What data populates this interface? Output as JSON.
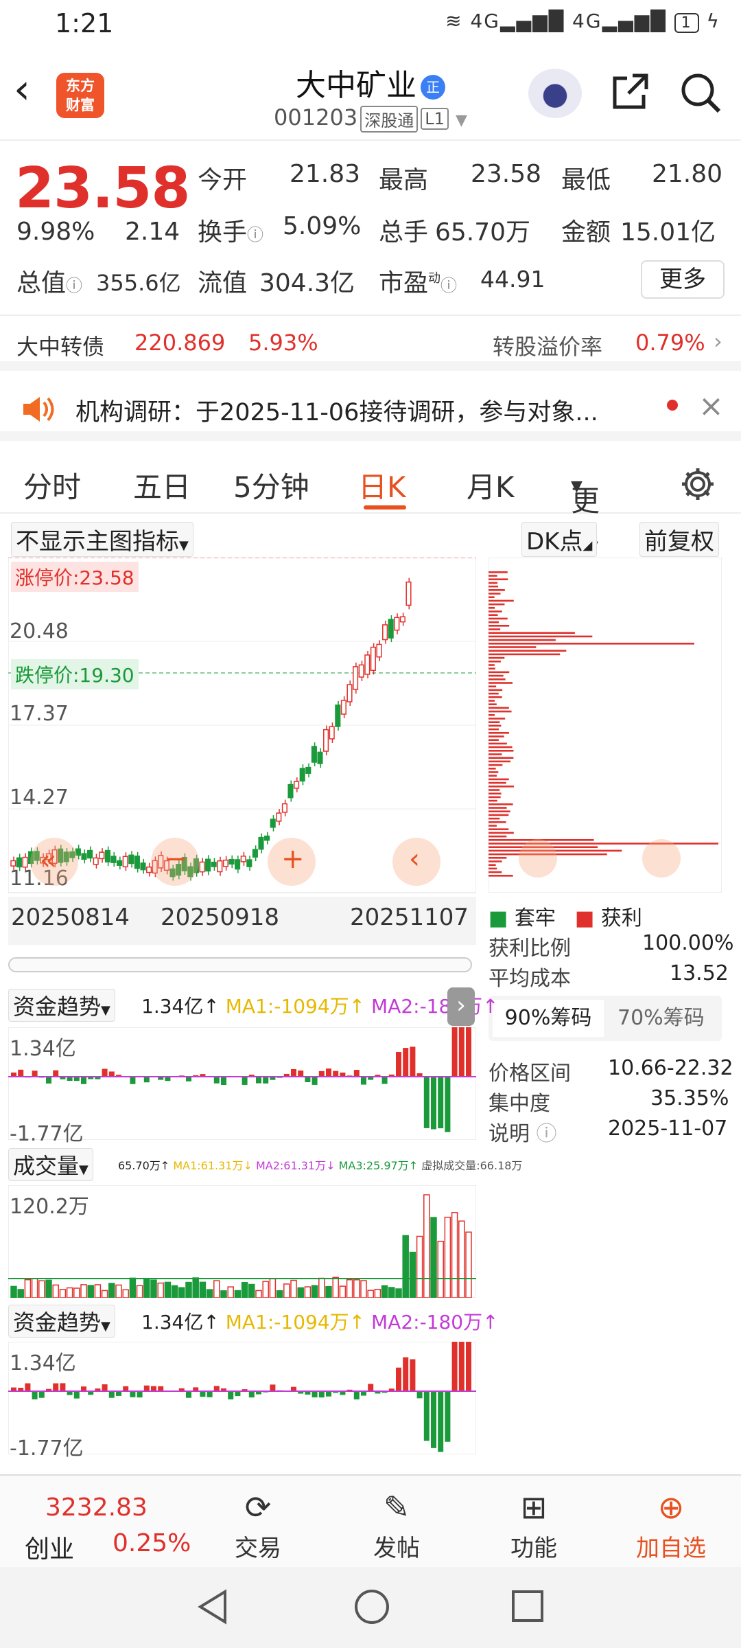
{
  "status": {
    "time": "1:21",
    "net1": "4G",
    "net2": "4G",
    "battery": "1"
  },
  "header": {
    "logo_line1": "东方",
    "logo_line2": "财富",
    "name": "大中矿业",
    "name_badge": "正",
    "code": "001203",
    "tag1": "深股通",
    "tag2": "L1"
  },
  "quote": {
    "price": "23.58",
    "pct": "9.98%",
    "chg": "2.14",
    "open_label": "今开",
    "open": "21.83",
    "high_label": "最高",
    "high": "23.58",
    "low_label": "最低",
    "low": "21.80",
    "turnover_label": "换手",
    "turnover": "5.09%",
    "vol_label": "总手",
    "vol": "65.70万",
    "amount_label": "金额",
    "amount": "15.01亿",
    "mcap_label": "总值",
    "mcap": "355.6亿",
    "float_label": "流值",
    "float": "304.3亿",
    "pe_label": "市盈",
    "pe_sup": "动",
    "pe": "44.91",
    "more": "更多"
  },
  "bond": {
    "name": "大中转债",
    "price": "220.869",
    "pct": "5.93%",
    "premium_label": "转股溢价率",
    "premium": "0.79%"
  },
  "notice": {
    "text": "机构调研：于2025-11-06接待调研，参与对象..."
  },
  "tabs": [
    "分时",
    "五日",
    "5分钟",
    "日K",
    "月K",
    "更多"
  ],
  "active_tab": "日K",
  "kchart": {
    "indicator_select": "不显示主图指标",
    "dk_label": "DK点",
    "fq_label": "前复权",
    "limit_up_label": "涨停价:23.58",
    "limit_down_label": "跌停价:19.30",
    "y_labels": [
      "23.58",
      "20.48",
      "17.37",
      "14.27",
      "11.16"
    ],
    "x_labels": [
      "20250814",
      "20250918",
      "20251107"
    ]
  },
  "chip": {
    "legend_trapped": "套牢",
    "legend_profit": "获利",
    "rows": [
      {
        "label": "获利比例",
        "value": "100.00%"
      },
      {
        "label": "平均成本",
        "value": "13.52"
      }
    ],
    "tab1": "90%筹码",
    "tab2": "70%筹码",
    "rows2": [
      {
        "label": "价格区间",
        "value": "10.66-22.32"
      },
      {
        "label": "集中度",
        "value": "35.35%"
      },
      {
        "label": "说明",
        "value": "2025-11-07"
      }
    ]
  },
  "fund1": {
    "name": "资金趋势",
    "v": "1.34亿↑",
    "ma1": "MA1:-1094万↑",
    "ma2": "MA2:-180万↑",
    "top": "1.34亿",
    "bottom": "-1.77亿"
  },
  "volume": {
    "name": "成交量",
    "v": "65.70万↑",
    "ma1": "MA1:61.31万↓",
    "ma2": "MA2:61.31万↓",
    "ma3": "MA3:25.97万↑",
    "virtual": "虚拟成交量:66.18万",
    "top": "120.2万"
  },
  "fund2": {
    "name": "资金趋势",
    "v": "1.34亿↑",
    "ma1": "MA1:-1094万↑",
    "ma2": "MA2:-180万↑",
    "top": "1.34亿",
    "bottom": "-1.77亿"
  },
  "bottom": {
    "index_value": "3232.83",
    "index_name": "创业",
    "index_pct": "0.25%",
    "trade": "交易",
    "post": "发帖",
    "func": "功能",
    "fav": "加自选"
  },
  "colors": {
    "up": "#e0302b",
    "down": "#1a9a3a",
    "brand": "#f0542b"
  }
}
